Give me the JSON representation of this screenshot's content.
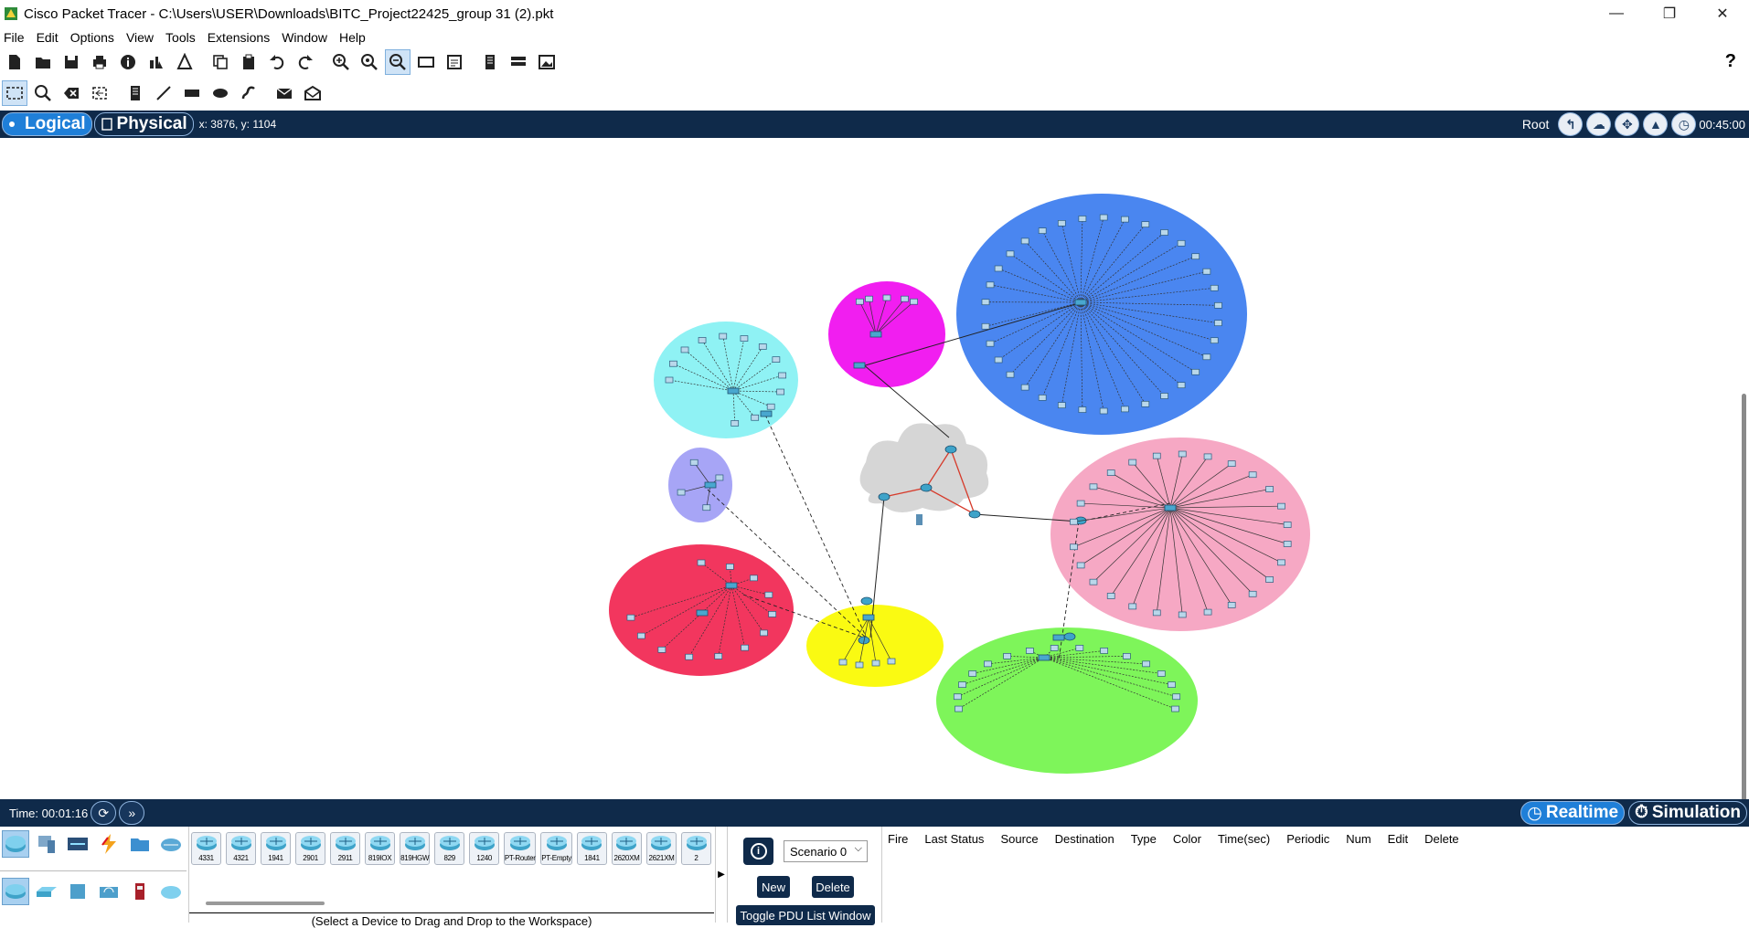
{
  "window": {
    "title": "Cisco Packet Tracer - C:\\Users\\USER\\Downloads\\BITC_Project22425_group 31 (2).pkt",
    "controls": [
      "—",
      "❐",
      "✕"
    ]
  },
  "menu": [
    "File",
    "Edit",
    "Options",
    "View",
    "Tools",
    "Extensions",
    "Window",
    "Help"
  ],
  "toolbar1": [
    "new-icon",
    "open-icon",
    "save-icon",
    "print-icon",
    "info-icon",
    "network-wizard-icon",
    "activity-wizard-icon",
    "copy-icon",
    "paste-icon",
    "undo-icon",
    "redo-icon",
    "zoom-in-icon",
    "zoom-reset-icon",
    "zoom-out-icon",
    "drawing-palette-icon",
    "custom-device-icon",
    "viewport-icon",
    "cluster-icon",
    "image-icon"
  ],
  "toolbar2": [
    "select-icon",
    "inspect-icon",
    "delete-icon",
    "resize-icon",
    "note-icon",
    "line-icon",
    "rectangle-icon",
    "ellipse-icon",
    "freeform-icon",
    "simple-pdu-icon",
    "complex-pdu-icon"
  ],
  "help": "?",
  "modebar": {
    "logical": "Logical",
    "physical": "Physical",
    "coords": "x: 3876, y: 1104",
    "root": "Root",
    "clock": "00:45:00"
  },
  "timebar": {
    "time": "Time: 00:01:16",
    "realtime": "Realtime",
    "simulation": "Simulation"
  },
  "devices": [
    "4331",
    "4321",
    "1941",
    "2901",
    "2911",
    "819IOX",
    "819HGW",
    "829",
    "1240",
    "PT-Router",
    "PT-Empty",
    "1841",
    "2620XM",
    "2621XM",
    "2"
  ],
  "device_hint": "(Select a Device to Drag and Drop to the Workspace)",
  "pdu": {
    "scenario": "Scenario 0",
    "new": "New",
    "delete": "Delete",
    "toggle": "Toggle PDU List Window",
    "columns": [
      "Fire",
      "Last Status",
      "Source",
      "Destination",
      "Type",
      "Color",
      "Time(sec)",
      "Periodic",
      "Num",
      "Edit",
      "Delete"
    ]
  },
  "colors": {
    "navy": "#0f2a4a",
    "accent": "#1f7fd8",
    "zone_blue": "#4a86f0",
    "zone_magenta": "#f11ef0",
    "zone_cyan": "#8ff2f4",
    "zone_lavender": "#a7a5f6",
    "zone_red": "#f2365e",
    "zone_yellow": "#fafa12",
    "zone_pink": "#f6a8c4",
    "zone_green": "#7ef55a",
    "cloud": "#d6d6d6"
  }
}
